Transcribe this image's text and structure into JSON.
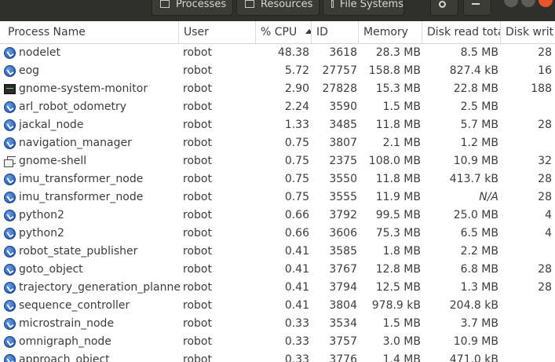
{
  "titlebar": {
    "tabs": [
      "Processes",
      "Resources",
      "File Systems"
    ]
  },
  "columns": {
    "name": "Process Name",
    "user": "User",
    "cpu": "% CPU",
    "id": "ID",
    "memory": "Memory",
    "disk_read": "Disk read tota",
    "disk_write": "Disk writ"
  },
  "rows": [
    {
      "icon": "process-gear-icon",
      "name": "nodelet",
      "user": "robot",
      "cpu": "48.38",
      "id": "3618",
      "memory": "28.3 MB",
      "disk_read": "8.5 MB",
      "disk_write": "28"
    },
    {
      "icon": "process-gear-icon",
      "name": "eog",
      "user": "robot",
      "cpu": "5.72",
      "id": "27757",
      "memory": "158.8 MB",
      "disk_read": "827.4 kB",
      "disk_write": "16"
    },
    {
      "icon": "system-monitor-icon",
      "name": "gnome-system-monitor",
      "user": "robot",
      "cpu": "2.90",
      "id": "27828",
      "memory": "15.3 MB",
      "disk_read": "22.8 MB",
      "disk_write": "188"
    },
    {
      "icon": "process-gear-icon",
      "name": "arl_robot_odometry",
      "user": "robot",
      "cpu": "2.24",
      "id": "3590",
      "memory": "1.5 MB",
      "disk_read": "2.5 MB",
      "disk_write": ""
    },
    {
      "icon": "process-gear-icon",
      "name": "jackal_node",
      "user": "robot",
      "cpu": "1.33",
      "id": "3485",
      "memory": "11.8 MB",
      "disk_read": "5.7 MB",
      "disk_write": "28"
    },
    {
      "icon": "process-gear-icon",
      "name": "navigation_manager",
      "user": "robot",
      "cpu": "0.75",
      "id": "3807",
      "memory": "2.1 MB",
      "disk_read": "1.2 MB",
      "disk_write": ""
    },
    {
      "icon": "window-icon",
      "name": "gnome-shell",
      "user": "robot",
      "cpu": "0.75",
      "id": "2375",
      "memory": "108.0 MB",
      "disk_read": "10.9 MB",
      "disk_write": "32"
    },
    {
      "icon": "process-gear-icon",
      "name": "imu_transformer_node",
      "user": "robot",
      "cpu": "0.75",
      "id": "3550",
      "memory": "11.8 MB",
      "disk_read": "413.7 kB",
      "disk_write": "28"
    },
    {
      "icon": "process-gear-icon",
      "name": "imu_transformer_node",
      "user": "robot",
      "cpu": "0.75",
      "id": "3555",
      "memory": "11.9 MB",
      "disk_read": "N/A",
      "disk_write": "28"
    },
    {
      "icon": "process-gear-icon",
      "name": "python2",
      "user": "robot",
      "cpu": "0.66",
      "id": "3792",
      "memory": "99.5 MB",
      "disk_read": "25.0 MB",
      "disk_write": "4"
    },
    {
      "icon": "process-gear-icon",
      "name": "python2",
      "user": "robot",
      "cpu": "0.66",
      "id": "3606",
      "memory": "75.3 MB",
      "disk_read": "6.5 MB",
      "disk_write": "4"
    },
    {
      "icon": "process-gear-icon",
      "name": "robot_state_publisher",
      "user": "robot",
      "cpu": "0.41",
      "id": "3585",
      "memory": "1.8 MB",
      "disk_read": "2.2 MB",
      "disk_write": ""
    },
    {
      "icon": "process-gear-icon",
      "name": "goto_object",
      "user": "robot",
      "cpu": "0.41",
      "id": "3767",
      "memory": "12.8 MB",
      "disk_read": "6.8 MB",
      "disk_write": "28"
    },
    {
      "icon": "process-gear-icon",
      "name": "trajectory_generation_planner",
      "user": "robot",
      "cpu": "0.41",
      "id": "3794",
      "memory": "12.5 MB",
      "disk_read": "1.3 MB",
      "disk_write": "28"
    },
    {
      "icon": "process-gear-icon",
      "name": "sequence_controller",
      "user": "robot",
      "cpu": "0.41",
      "id": "3804",
      "memory": "978.9 kB",
      "disk_read": "204.8 kB",
      "disk_write": ""
    },
    {
      "icon": "process-gear-icon",
      "name": "microstrain_node",
      "user": "robot",
      "cpu": "0.33",
      "id": "3534",
      "memory": "1.5 MB",
      "disk_read": "3.7 MB",
      "disk_write": ""
    },
    {
      "icon": "process-gear-icon",
      "name": "omnigraph_node",
      "user": "robot",
      "cpu": "0.33",
      "id": "3757",
      "memory": "3.0 MB",
      "disk_read": "10.9 MB",
      "disk_write": ""
    },
    {
      "icon": "process-gear-icon",
      "name": "approach_object",
      "user": "robot",
      "cpu": "0.33",
      "id": "3776",
      "memory": "1.4 MB",
      "disk_read": "471.0 kB",
      "disk_write": ""
    }
  ]
}
